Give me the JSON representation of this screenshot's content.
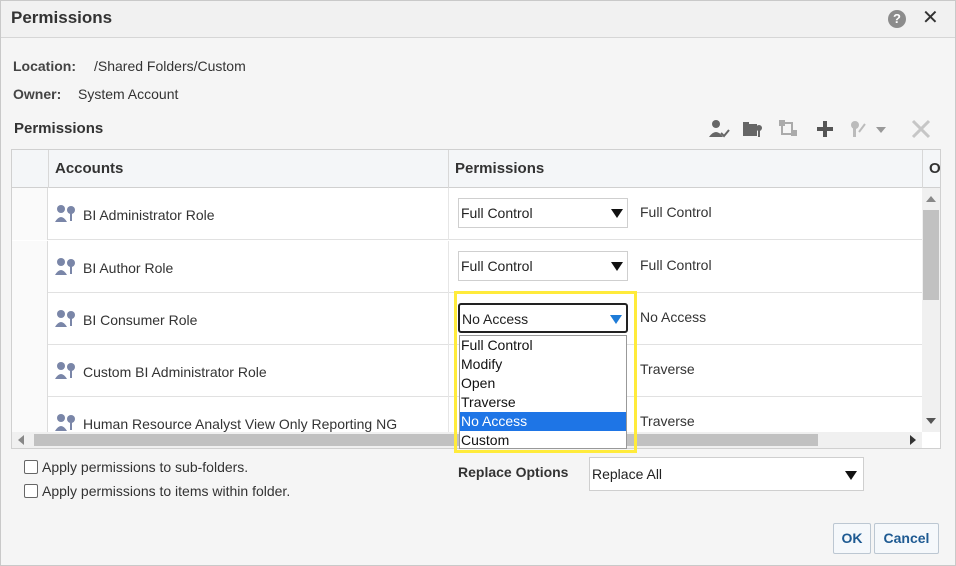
{
  "dialog": {
    "title": "Permissions",
    "help_icon": "help-icon",
    "close_icon": "close-icon",
    "close_glyph": "✕"
  },
  "meta": {
    "location_label": "Location:",
    "location_value": "/Shared Folders/Custom",
    "owner_label": "Owner:",
    "owner_value": "System Account"
  },
  "permissions_section": {
    "title": "Permissions",
    "toolbar_icons": [
      "add-users-icon",
      "add-roles-icon",
      "copy-permissions-icon",
      "add-icon",
      "set-permissions-icon",
      "delete-icon"
    ]
  },
  "table": {
    "headers": {
      "accounts": "Accounts",
      "permissions": "Permissions",
      "extra": "O"
    },
    "rows": [
      {
        "name": "BI Administrator Role",
        "select": "Full Control",
        "perm": "Full Control"
      },
      {
        "name": "BI Author Role",
        "select": "Full Control",
        "perm": "Full Control"
      },
      {
        "name": "BI Consumer Role",
        "select": "No Access",
        "perm": "No Access"
      },
      {
        "name": "Custom BI Administrator Role",
        "select": "",
        "perm": "Traverse"
      },
      {
        "name": "Human Resource Analyst View Only Reporting NG",
        "select": "",
        "perm": "Traverse"
      }
    ]
  },
  "dropdown": {
    "options": [
      "Full Control",
      "Modify",
      "Open",
      "Traverse",
      "No Access",
      "Custom"
    ],
    "selected": "No Access"
  },
  "options": {
    "apply_subfolders": "Apply permissions to sub-folders.",
    "apply_items": "Apply permissions to items within folder.",
    "replace_label": "Replace Options",
    "replace_value": "Replace All"
  },
  "buttons": {
    "ok": "OK",
    "cancel": "Cancel"
  },
  "colors": {
    "accent": "#1e75e6",
    "highlight": "#ffeb3b",
    "button_text": "#1e5a92"
  }
}
